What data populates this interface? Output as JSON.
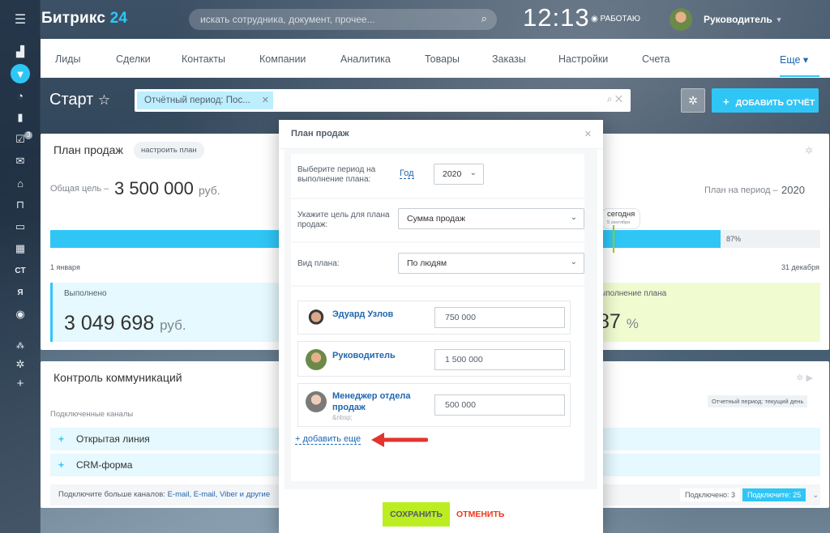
{
  "sidebar": {
    "icons": [
      "menu-icon",
      "funnel-icon",
      "clock-icon",
      "chart-icon",
      "tasks-icon",
      "mail-icon",
      "store-icon",
      "cart-icon",
      "calendar-icon",
      "grid-icon",
      "ct-icon",
      "ya-icon",
      "check-icon",
      "sitemap-icon",
      "gear-icon",
      "plus-icon"
    ],
    "ct": "CT",
    "ya": "Я",
    "tasks_badge": "3"
  },
  "header": {
    "logo": "Битрикс",
    "logo_num": "24",
    "search_placeholder": "искать сотрудника, документ, прочее...",
    "time": "12:13",
    "status": "РАБОТАЮ",
    "user": "Руководитель"
  },
  "nav": {
    "items": [
      "Лиды",
      "Сделки",
      "Контакты",
      "Компании",
      "Аналитика",
      "Товары",
      "Заказы",
      "Настройки",
      "Счета"
    ],
    "more": "Еще"
  },
  "toolbar": {
    "title": "Старт",
    "filter_chip": "Отчётный период: Пос...",
    "add_report": "ДОБАВИТЬ ОТЧЁТ"
  },
  "sales": {
    "title": "План продаж",
    "configure": "настроить план",
    "goal_label": "Общая цель",
    "goal_value": "3 500 000",
    "currency": "руб.",
    "period_label": "План на период",
    "period_value": "2020",
    "progress": 0.87,
    "progress_label": "87%",
    "today_label": "сегодня",
    "today_date": "5 сентября",
    "start_date": "1 января",
    "end_date": "31 декабря",
    "done_label": "Выполнено",
    "done_value": "3 049 698",
    "exec_label": "ыполнение плана",
    "exec_value": "87",
    "exec_unit": "%"
  },
  "comms": {
    "title": "Контроль коммуникаций",
    "channels_label": "Подключенные каналы",
    "period": "Отчетный период: текущий день",
    "rows": [
      "Открытая линия",
      "CRM-форма"
    ],
    "footer_text": "Подключите больше каналов:",
    "footer_links": "E-mail, E-mail, Viber и другие",
    "connected": "Подключено: 3",
    "connect": "Подключите: 25"
  },
  "modal": {
    "title": "План продаж",
    "period_label": "Выберите период на выполнение плана:",
    "period_link": "Год",
    "year": "2020",
    "goal_label": "Укажите цель для плана продаж:",
    "goal_value": "Сумма продаж",
    "type_label": "Вид плана:",
    "type_value": "По людям",
    "employees": [
      {
        "name": "Эдуард Узлов",
        "amount": "750 000"
      },
      {
        "name": "Руководитель",
        "amount": "1 500 000"
      },
      {
        "name": "Менеджер отдела продаж",
        "sub": "&nbsp;",
        "amount": "500 000"
      }
    ],
    "add_more": "+ добавить еще",
    "save": "СОХРАНИТЬ",
    "cancel": "ОТМЕНИТЬ"
  }
}
